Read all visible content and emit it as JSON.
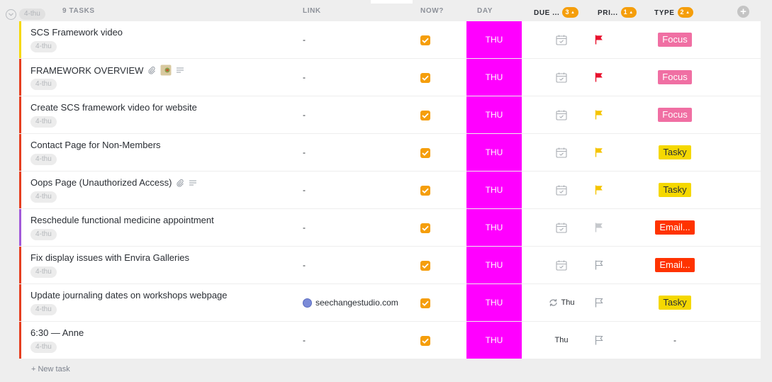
{
  "group": {
    "status_pill": "4-thu",
    "task_count": "9 TASKS"
  },
  "columns": {
    "link": "LINK",
    "now": "NOW?",
    "day": "DAY",
    "due": "DUE ...",
    "due_count": "3",
    "priority": "PRI...",
    "priority_count": "1",
    "type": "TYPE",
    "type_count": "2"
  },
  "colors": {
    "day_cell": "#ff00ff",
    "checkbox": "#f59e0b",
    "focus": "#f06fa3",
    "tasky": "#f5d800",
    "email": "#ff3300",
    "flag_urgent": "#e8112d",
    "flag_high": "#f5c400",
    "flag_normal": "#c5c8cc"
  },
  "tasks": [
    {
      "name": "SCS Framework video",
      "tag": "4-thu",
      "link": "-",
      "now": true,
      "day": "THU",
      "due": "",
      "due_icon": "calendar-icon",
      "priority": "urgent",
      "type": "Focus",
      "type_style": "focus",
      "stripe": "#f5d800",
      "extras": []
    },
    {
      "name": "FRAMEWORK OVERVIEW",
      "tag": "4-thu",
      "link": "-",
      "now": true,
      "day": "THU",
      "due": "",
      "due_icon": "calendar-icon",
      "priority": "urgent",
      "type": "Focus",
      "type_style": "focus",
      "stripe": "#e53e1f",
      "extras": [
        "paperclip-icon",
        "thumbnail-icon",
        "description-icon"
      ]
    },
    {
      "name": "Create SCS framework video for website",
      "tag": "4-thu",
      "link": "-",
      "now": true,
      "day": "THU",
      "due": "",
      "due_icon": "calendar-icon",
      "priority": "high",
      "type": "Focus",
      "type_style": "focus",
      "stripe": "#e53e1f",
      "extras": []
    },
    {
      "name": "Contact Page for Non-Members",
      "tag": "4-thu",
      "link": "-",
      "now": true,
      "day": "THU",
      "due": "",
      "due_icon": "calendar-icon",
      "priority": "high",
      "type": "Tasky",
      "type_style": "tasky",
      "stripe": "#e53e1f",
      "extras": []
    },
    {
      "name": "Oops Page (Unauthorized Access)",
      "tag": "4-thu",
      "link": "-",
      "now": true,
      "day": "THU",
      "due": "",
      "due_icon": "calendar-icon",
      "priority": "high",
      "type": "Tasky",
      "type_style": "tasky",
      "stripe": "#e53e1f",
      "extras": [
        "paperclip-icon",
        "description-icon"
      ]
    },
    {
      "name": "Reschedule functional medicine appointment",
      "tag": "4-thu",
      "link": "-",
      "now": true,
      "day": "THU",
      "due": "",
      "due_icon": "calendar-icon",
      "priority": "normal",
      "type": "Email...",
      "type_style": "email",
      "stripe": "#a259d9",
      "extras": []
    },
    {
      "name": "Fix display issues with Envira Galleries",
      "tag": "4-thu",
      "link": "-",
      "now": true,
      "day": "THU",
      "due": "",
      "due_icon": "calendar-icon",
      "priority": "none",
      "type": "Email...",
      "type_style": "email",
      "stripe": "#e53e1f",
      "extras": []
    },
    {
      "name": "Update journaling dates on workshops webpage",
      "tag": "4-thu",
      "link": "seechangestudio.com",
      "now": true,
      "day": "THU",
      "due": "Thu",
      "due_icon": "recurring-icon",
      "priority": "none",
      "type": "Tasky",
      "type_style": "tasky",
      "stripe": "#e53e1f",
      "extras": []
    },
    {
      "name": "6:30 — Anne",
      "tag": "4-thu",
      "link": "-",
      "now": true,
      "day": "THU",
      "due": "Thu",
      "due_icon": "",
      "priority": "none",
      "type": "-",
      "type_style": "none",
      "stripe": "#e53e1f",
      "extras": []
    }
  ],
  "footer": {
    "new_task": "+ New task"
  }
}
